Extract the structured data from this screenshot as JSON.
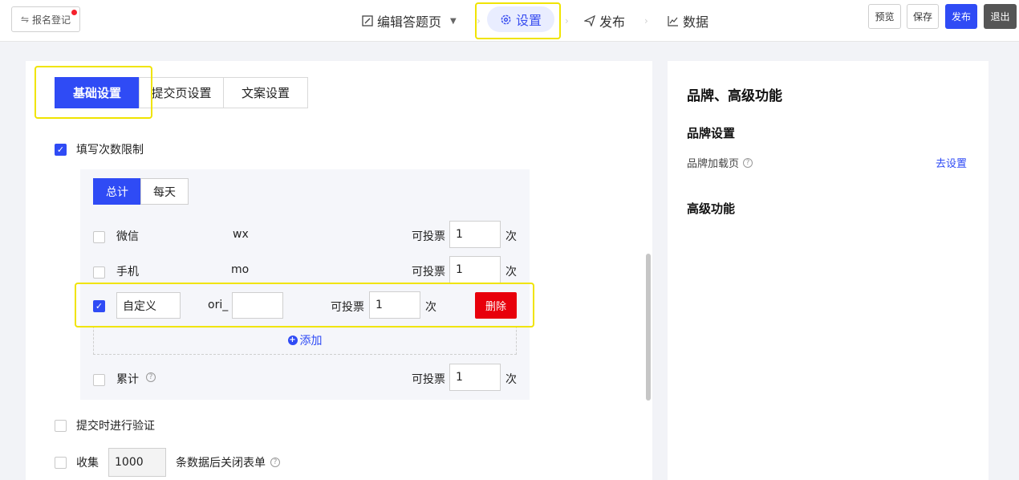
{
  "topbar": {
    "back_label": "报名登记",
    "nav": {
      "edit": "编辑答题页",
      "settings": "设置",
      "publish": "发布",
      "data": "数据"
    },
    "buttons": {
      "preview": "预览",
      "save": "保存",
      "publish": "发布",
      "exit": "退出"
    }
  },
  "tabs": [
    "基础设置",
    "提交页设置",
    "文案设置"
  ],
  "fill_limit": {
    "label": "填写次数限制",
    "checked": true,
    "segments": [
      "总计",
      "每天"
    ],
    "rows": [
      {
        "name": "微信",
        "key": "wx",
        "vote_label": "可投票",
        "value": "1",
        "unit": "次"
      },
      {
        "name": "手机",
        "key": "mo",
        "vote_label": "可投票",
        "value": "1",
        "unit": "次"
      }
    ],
    "custom_row": {
      "name": "自定义",
      "prefix": "ori_",
      "key_value": "",
      "vote_label": "可投票",
      "value": "1",
      "unit": "次",
      "delete_label": "删除"
    },
    "add_label": "添加",
    "cumulative": {
      "name": "累计",
      "vote_label": "可投票",
      "value": "1",
      "unit": "次"
    }
  },
  "verify": {
    "label": "提交时进行验证"
  },
  "collect": {
    "prefix": "收集",
    "value": "1000",
    "suffix": "条数据后关闭表单"
  },
  "right_panel": {
    "title": "品牌、高级功能",
    "brand_section": "品牌设置",
    "brand_loading": "品牌加载页",
    "go_settings": "去设置",
    "advanced_section": "高级功能"
  },
  "colors": {
    "primary": "#2f4bf5",
    "danger": "#e8000b",
    "highlight": "#f0e400"
  }
}
